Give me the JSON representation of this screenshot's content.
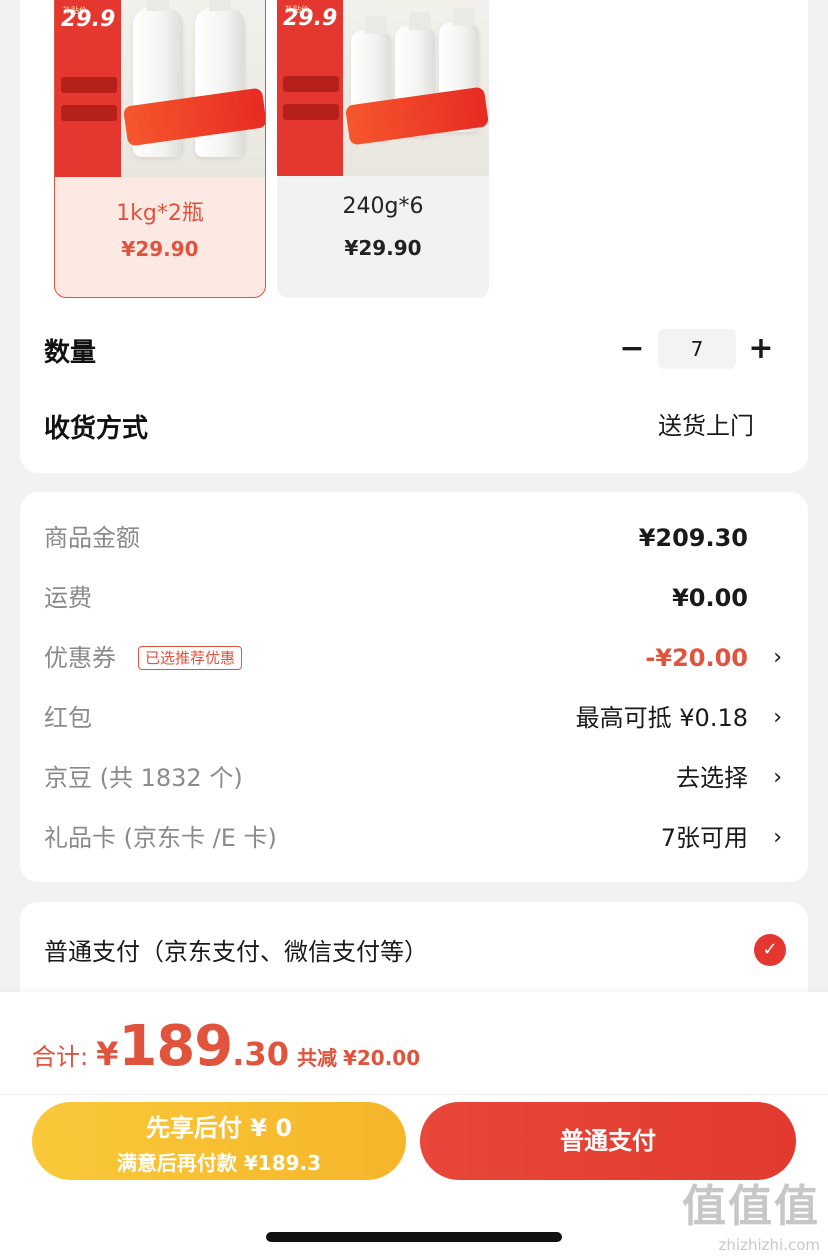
{
  "options": [
    {
      "label": "1kg*2瓶",
      "price": "¥29.90",
      "selected": true,
      "thumb": {
        "price": "29.9",
        "tag": "补贴价"
      }
    },
    {
      "label": "240g*6",
      "price": "¥29.90",
      "selected": false,
      "thumb": {
        "price": "29.9",
        "tag": "补贴价"
      }
    }
  ],
  "quantity": {
    "label": "数量",
    "minus": "−",
    "plus": "+",
    "value": "7"
  },
  "delivery": {
    "label": "收货方式",
    "value": "送货上门"
  },
  "price_detail": {
    "goods_amount": {
      "label": "商品金额",
      "value": "¥209.30"
    },
    "shipping": {
      "label": "运费",
      "value": "¥0.00"
    },
    "coupon": {
      "label": "优惠券",
      "badge": "已选推荐优惠",
      "value": "-¥20.00"
    },
    "red_packet": {
      "label": "红包",
      "value": "最高可抵 ¥0.18"
    },
    "jingdou": {
      "label": "京豆 (共 1832 个)",
      "value": "去选择"
    },
    "gift_card": {
      "label": "礼品卡 (京东卡 /E 卡)",
      "value": "7张可用"
    },
    "chevron": "›"
  },
  "payment": {
    "label": "普通支付（京东支付、微信支付等）",
    "check": "✓"
  },
  "total": {
    "label": "合计:",
    "currency": "¥",
    "integer": "189",
    "decimal": ".30",
    "saved_label": "共减",
    "saved": "¥20.00"
  },
  "buttons": {
    "later_line1": "先享后付 ¥ 0",
    "later_line2": "满意后再付款 ¥189.3",
    "pay": "普通支付"
  },
  "watermark": {
    "logo": "值值值",
    "url": "zhizhizhi.com"
  },
  "colors": {
    "accent": "#e0533d",
    "later_button": "#f8c236",
    "pay_button": "#e5403a",
    "background": "#f2f2f2"
  }
}
